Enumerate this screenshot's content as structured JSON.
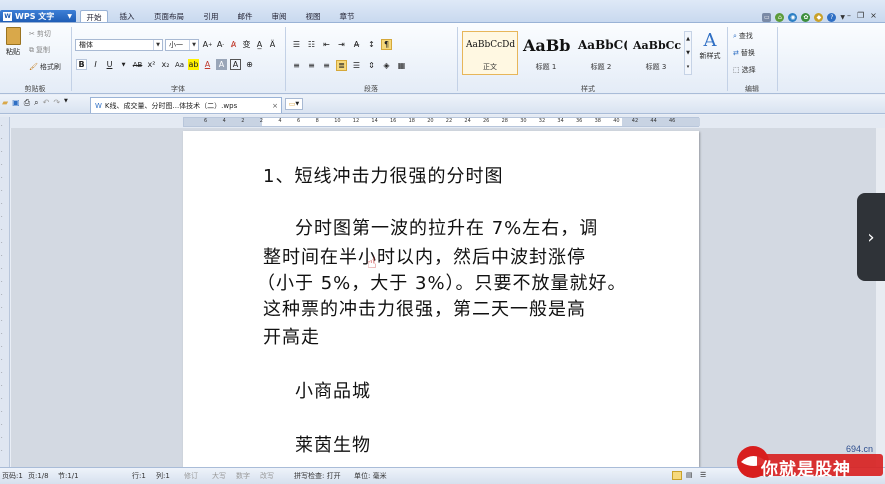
{
  "app": {
    "menu_label": "WPS 文字"
  },
  "tabs": [
    "开始",
    "插入",
    "页面布局",
    "引用",
    "邮件",
    "审阅",
    "视图",
    "章节"
  ],
  "ribbon": {
    "clipboard": {
      "paste": "粘贴",
      "cut": "剪切",
      "copy": "复制",
      "format_painter": "格式刷",
      "label": "剪贴板"
    },
    "font": {
      "name": "楷体",
      "size": "小一",
      "label": "字体"
    },
    "paragraph": {
      "label": "段落"
    },
    "styles": {
      "label": "样式",
      "items": [
        {
          "sample": "AaBbCcDd",
          "name": "正文"
        },
        {
          "sample": "AaBb(",
          "name": "标题 1"
        },
        {
          "sample": "AaBbC(",
          "name": "标题 2"
        },
        {
          "sample": "AaBbCc",
          "name": "标题 3"
        }
      ],
      "new_style": "新样式"
    },
    "editing": {
      "find": "查找",
      "replace": "替换",
      "select": "选择",
      "label": "编辑"
    }
  },
  "document_tab": {
    "title": "K线、成交量、分时图...体技术（二）.wps"
  },
  "ruler_ticks": [
    "6",
    "4",
    "2",
    "2",
    "4",
    "6",
    "8",
    "10",
    "12",
    "14",
    "16",
    "18",
    "20",
    "22",
    "24",
    "26",
    "28",
    "30",
    "32",
    "34",
    "36",
    "38",
    "40",
    "42",
    "44",
    "46"
  ],
  "document": {
    "lines": [
      "1、短线冲击力很强的分时图",
      "分时图第一波的拉升在 7%左右，调",
      "整时间在半小时以内，然后中波封涨停",
      "（小于 5%，大于 3%）。只要不放量就好。",
      "这种票的冲击力很强，第二天一般是高",
      "开高走",
      "小商品城",
      "莱茵生物"
    ]
  },
  "statusbar": {
    "page_no": "页码:1",
    "page": "页:1/8",
    "section": "节:1/1",
    "row": "行:1",
    "col": "列:1",
    "rev": "修订",
    "caps": "大写",
    "num": "数字",
    "ovr": "改写",
    "spell": "拼写检查: 打开",
    "unit": "单位: 毫米",
    "zoom": "100 %"
  },
  "watermark": {
    "text": "你就是股神",
    "site": "694.cn"
  },
  "colors": {
    "accent": "#1d5bb4",
    "ribbon_bg": "#e4ecf7",
    "workspace": "#d3d9e2"
  }
}
